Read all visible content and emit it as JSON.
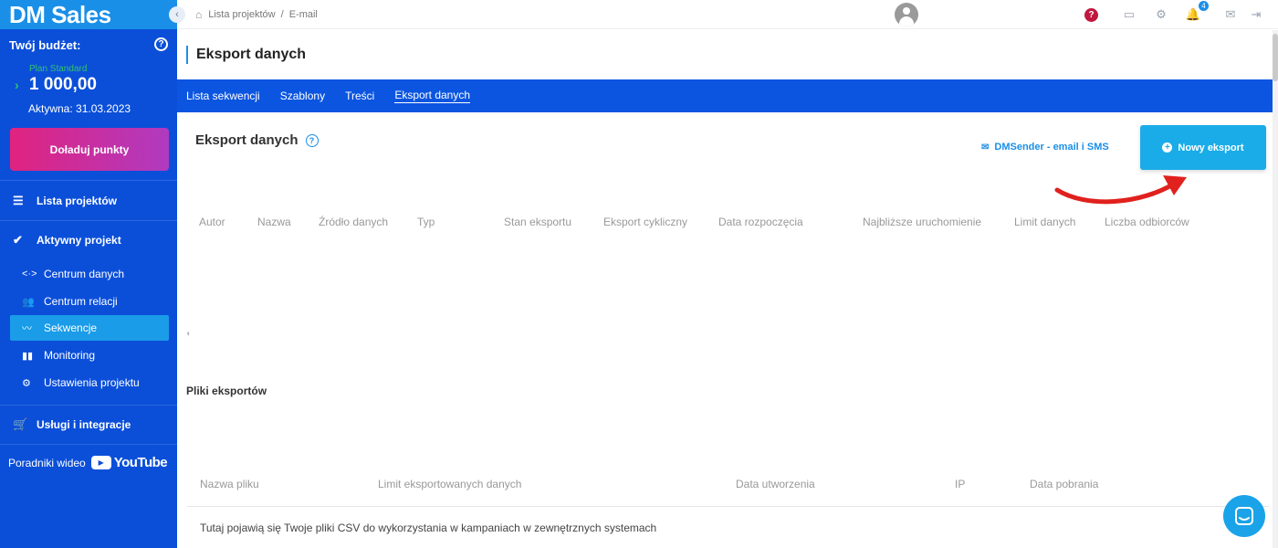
{
  "sidebar": {
    "logo": "DM Sales",
    "budget_title": "Twój budżet:",
    "plan": "Plan Standard",
    "amount": "1 000,00",
    "active_until": "Aktywna: 31.03.2023",
    "topup_button": "Doładuj punkty",
    "project_list": "Lista projektów",
    "active_project": "Aktywny projekt",
    "subitems": [
      "Centrum danych",
      "Centrum relacji",
      "Sekwencje",
      "Monitoring",
      "Ustawienia projektu"
    ],
    "services": "Usługi i integracje",
    "video_guides": "Poradniki wideo",
    "youtube": "YouTube"
  },
  "topbar": {
    "breadcrumb": [
      "Lista projektów",
      "E-mail"
    ],
    "notification_count": "4"
  },
  "page": {
    "title": "Eksport danych",
    "tabs": [
      "Lista sekwencji",
      "Szablony",
      "Treści",
      "Eksport danych"
    ],
    "active_tab": "Eksport danych"
  },
  "exports": {
    "title": "Eksport danych",
    "dmsender_link": "DMSender - email i SMS",
    "new_button": "Nowy eksport",
    "columns": [
      "Autor",
      "Nazwa",
      "Źródło danych",
      "Typ",
      "Stan eksportu",
      "Eksport cykliczny",
      "Data rozpoczęcia",
      "Najbliższe uruchomienie",
      "Limit danych",
      "Liczba odbiorców"
    ]
  },
  "files": {
    "title": "Pliki eksportów",
    "columns": [
      "Nazwa pliku",
      "Limit eksportowanych danych",
      "Data utworzenia",
      "IP",
      "Data pobrania"
    ],
    "empty_message": "Tutaj pojawią się Twoje pliki CSV do wykorzystania w kampaniach w zewnętrznych systemach"
  },
  "colors": {
    "sidebar": "#0b4fd9",
    "tabs_bar": "#0b55e0",
    "accent": "#1aace8",
    "topup_gradient_start": "#e0237f",
    "annotation_arrow": "#e0211d"
  }
}
